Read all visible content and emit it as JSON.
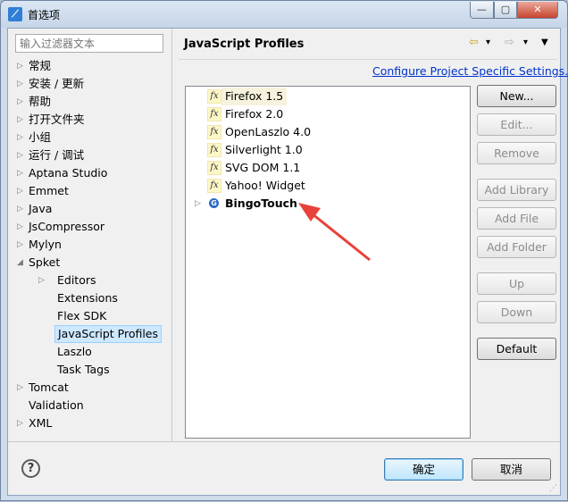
{
  "window": {
    "title": "首选项",
    "min": "—",
    "max": "▢",
    "close": "✕"
  },
  "filter": {
    "placeholder": "输入过滤器文本"
  },
  "tree": [
    {
      "label": "常规",
      "expander": "▷",
      "selected": false
    },
    {
      "label": "安装 / 更新",
      "expander": "▷",
      "selected": false
    },
    {
      "label": "帮助",
      "expander": "▷",
      "selected": false
    },
    {
      "label": "打开文件夹",
      "expander": "▷",
      "selected": false
    },
    {
      "label": "小组",
      "expander": "▷",
      "selected": false
    },
    {
      "label": "运行 / 调试",
      "expander": "▷",
      "selected": false
    },
    {
      "label": "Aptana Studio",
      "expander": "▷",
      "selected": false
    },
    {
      "label": "Emmet",
      "expander": "▷",
      "selected": false
    },
    {
      "label": "Java",
      "expander": "▷",
      "selected": false
    },
    {
      "label": "JsCompressor",
      "expander": "▷",
      "selected": false
    },
    {
      "label": "Mylyn",
      "expander": "▷",
      "selected": false
    },
    {
      "label": "Spket",
      "expander": "◢",
      "selected": false
    },
    {
      "label": "Editors",
      "expander": "▷",
      "selected": false
    },
    {
      "label": "Extensions",
      "expander": "",
      "selected": false
    },
    {
      "label": "Flex SDK",
      "expander": "",
      "selected": false
    },
    {
      "label": "JavaScript Profiles",
      "expander": "",
      "selected": true
    },
    {
      "label": "Laszlo",
      "expander": "",
      "selected": false
    },
    {
      "label": "Task Tags",
      "expander": "",
      "selected": false
    },
    {
      "label": "Tomcat",
      "expander": "▷",
      "selected": false
    },
    {
      "label": "Validation",
      "expander": "",
      "selected": false
    },
    {
      "label": "XML",
      "expander": "▷",
      "selected": false
    }
  ],
  "page": {
    "title": "JavaScript Profiles",
    "nav": {
      "back": "⇦",
      "back_menu": "▾",
      "forward": "⇨",
      "forward_menu": "▾",
      "view_menu": "▼"
    },
    "configure_link": "Configure Project Specific Settings..."
  },
  "profiles": [
    {
      "name": "Firefox 1.5",
      "icon": "fx",
      "highlight": true,
      "bold": false
    },
    {
      "name": "Firefox 2.0",
      "icon": "fx",
      "highlight": false,
      "bold": false
    },
    {
      "name": "OpenLaszlo 4.0",
      "icon": "fx",
      "highlight": false,
      "bold": false
    },
    {
      "name": "Silverlight 1.0",
      "icon": "fx",
      "highlight": false,
      "bold": false
    },
    {
      "name": "SVG DOM 1.1",
      "icon": "fx",
      "highlight": false,
      "bold": false
    },
    {
      "name": "Yahoo! Widget",
      "icon": "fx",
      "highlight": false,
      "bold": false
    },
    {
      "name": "BingoTouch",
      "icon": "namespace",
      "highlight": false,
      "bold": true,
      "expander": "▷"
    }
  ],
  "buttons": [
    {
      "label": "New...",
      "enabled": true
    },
    {
      "label": "Edit...",
      "enabled": false
    },
    {
      "label": "Remove",
      "enabled": false
    },
    {
      "label": "Add Library",
      "enabled": false
    },
    {
      "label": "Add File",
      "enabled": false
    },
    {
      "label": "Add Folder",
      "enabled": false
    },
    {
      "label": "Up",
      "enabled": false
    },
    {
      "label": "Down",
      "enabled": false
    },
    {
      "label": "Default",
      "enabled": true
    }
  ],
  "footer": {
    "help": "?",
    "ok": "确定",
    "cancel": "取消"
  },
  "colors": {
    "annotation_arrow": "#e8423a",
    "link": "#0033cc",
    "selection": "#cde8ff"
  },
  "icons": {
    "fx_glyph": "fx",
    "namespace_glyph": "G"
  }
}
